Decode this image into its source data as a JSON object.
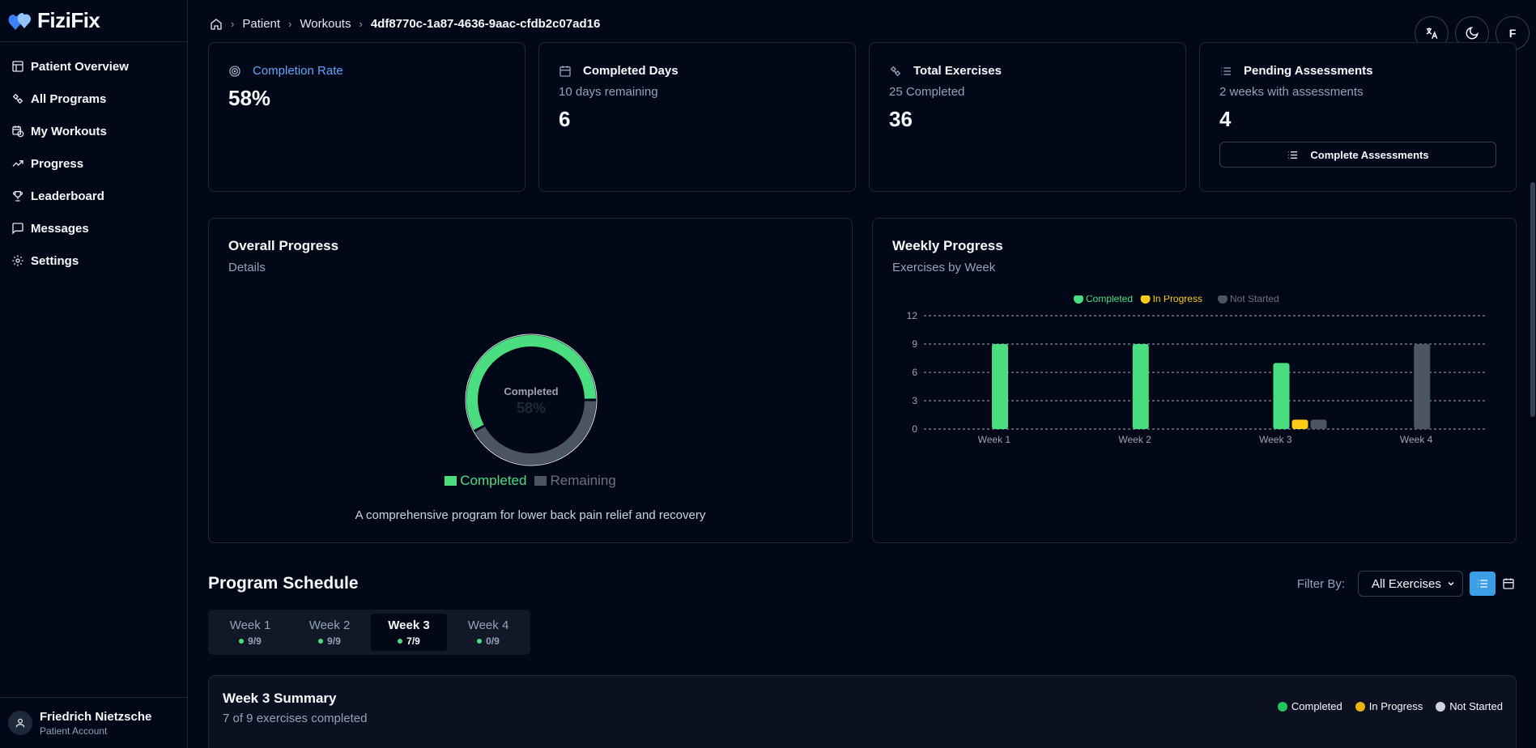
{
  "app": {
    "name": "FiziFix"
  },
  "sidebar": {
    "items": [
      {
        "label": "Patient Overview",
        "icon": "layout-dashboard-icon"
      },
      {
        "label": "All Programs",
        "icon": "dumbbell-icon"
      },
      {
        "label": "My Workouts",
        "icon": "calendar-clock-icon"
      },
      {
        "label": "Progress",
        "icon": "trending-up-icon"
      },
      {
        "label": "Leaderboard",
        "icon": "trophy-icon"
      },
      {
        "label": "Messages",
        "icon": "message-square-icon"
      },
      {
        "label": "Settings",
        "icon": "gear-icon"
      }
    ],
    "user": {
      "name": "Friedrich Nietzsche",
      "role": "Patient Account"
    }
  },
  "header": {
    "breadcrumbs": [
      "Patient",
      "Workouts",
      "4df8770c-1a87-4636-9aac-cfdb2c07ad16"
    ],
    "avatar_initial": "F"
  },
  "stats": {
    "completion": {
      "label": "Completion Rate",
      "value": "58%"
    },
    "days": {
      "label": "Completed Days",
      "sub": "10 days remaining",
      "value": "6"
    },
    "exercises": {
      "label": "Total Exercises",
      "sub": "25 Completed",
      "value": "36"
    },
    "assessments": {
      "label": "Pending Assessments",
      "sub": "2 weeks with assessments",
      "value": "4",
      "button": "Complete Assessments"
    }
  },
  "overall": {
    "title": "Overall Progress",
    "subtitle": "Details",
    "center_label": "Completed",
    "center_value": "58%",
    "legend": [
      "Completed",
      "Remaining"
    ],
    "description": "A comprehensive program for lower back pain relief and recovery"
  },
  "weekly": {
    "title": "Weekly Progress",
    "subtitle": "Exercises by Week"
  },
  "chart_data": [
    {
      "type": "pie",
      "categories": [
        "Completed",
        "Remaining"
      ],
      "values": [
        58,
        42
      ],
      "colors": [
        "#4ade80",
        "#4b5563"
      ]
    },
    {
      "type": "bar",
      "categories": [
        "Week 1",
        "Week 2",
        "Week 3",
        "Week 4"
      ],
      "series": [
        {
          "name": "Completed",
          "values": [
            9,
            9,
            7,
            0
          ],
          "color": "#4ade80"
        },
        {
          "name": "In Progress",
          "values": [
            0,
            0,
            1,
            0
          ],
          "color": "#facc15"
        },
        {
          "name": "Not Started",
          "values": [
            0,
            0,
            1,
            9
          ],
          "color": "#4b5563"
        }
      ],
      "ylim": [
        0,
        12
      ],
      "yticks": [
        0,
        3,
        6,
        9,
        12
      ],
      "legend": "top-center",
      "grid": true
    }
  ],
  "schedule": {
    "title": "Program Schedule",
    "filter_label": "Filter By:",
    "filter_value": "All Exercises",
    "tabs": [
      {
        "label": "Week 1",
        "count": "9/9"
      },
      {
        "label": "Week 2",
        "count": "9/9"
      },
      {
        "label": "Week 3",
        "count": "7/9"
      },
      {
        "label": "Week 4",
        "count": "0/9"
      }
    ],
    "active_tab": 2,
    "summary": {
      "title": "Week 3 Summary",
      "subtitle": "7 of 9 exercises completed",
      "legend": [
        "Completed",
        "In Progress",
        "Not Started"
      ]
    }
  }
}
